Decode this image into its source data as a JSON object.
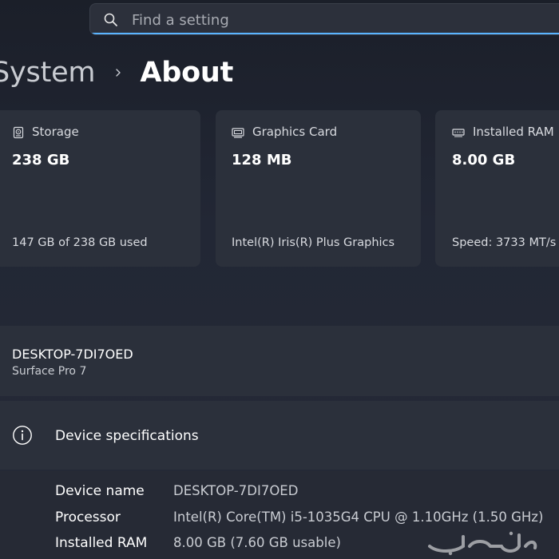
{
  "search": {
    "placeholder": "Find a setting",
    "value": ""
  },
  "breadcrumb": {
    "parent": "System",
    "current": "About"
  },
  "cards": [
    {
      "title": "Storage",
      "value": "238 GB",
      "detail": "147 GB of 238 GB used",
      "icon": "storage-drive-icon"
    },
    {
      "title": "Graphics Card",
      "value": "128 MB",
      "detail": "Intel(R) Iris(R) Plus Graphics",
      "icon": "graphics-card-icon"
    },
    {
      "title": "Installed RAM",
      "value": "8.00 GB",
      "detail": "Speed: 3733 MT/s",
      "icon": "ram-module-icon"
    }
  ],
  "device": {
    "hostname": "DESKTOP-7DI7OED",
    "model": "Surface Pro 7"
  },
  "specs": {
    "title": "Device specifications",
    "rows": [
      {
        "label": "Device name",
        "value": "DESKTOP-7DI7OED"
      },
      {
        "label": "Processor",
        "value": "Intel(R) Core(TM) i5-1035G4 CPU @ 1.10GHz (1.50 GHz)"
      },
      {
        "label": "Installed RAM",
        "value": "8.00 GB (7.60 GB usable)"
      }
    ]
  },
  "watermark": {
    "text": "حراج"
  },
  "colors": {
    "accent": "#5ab4ff",
    "background": "#1f2430",
    "card": "#2b303b"
  }
}
